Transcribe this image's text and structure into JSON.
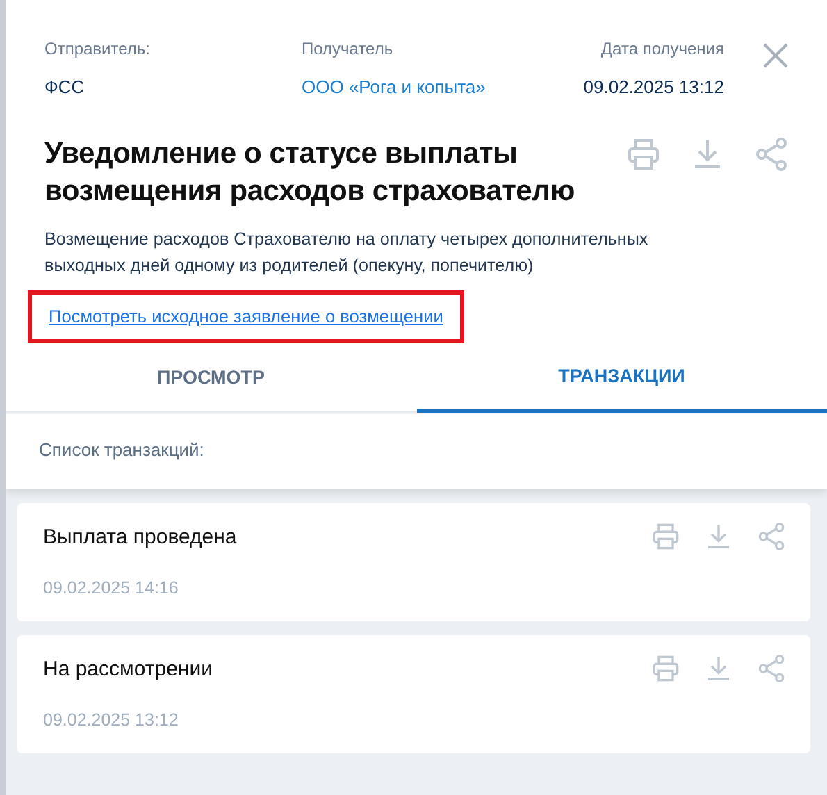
{
  "header": {
    "fields": [
      {
        "label": "Отправитель:",
        "value": "ФСС",
        "kind": "plain"
      },
      {
        "label": "Получатель",
        "value": "ООО «Рога и копыта»",
        "kind": "link"
      },
      {
        "label": "Дата получения",
        "value": "09.02.2025 13:12",
        "kind": "date"
      }
    ]
  },
  "title": "Уведомление о статусе выплаты возмещения расходов страхователю",
  "description": "Возмещение расходов Страхователю на оплату четырех дополнительных выходных дней одному из родителей (опекуну, попечителю)",
  "source_link": {
    "text": "Посмотреть исходное заявление о возмещении",
    "highlighted": true
  },
  "tabs": [
    {
      "label": "ПРОСМОТР",
      "selected": false
    },
    {
      "label": "ТРАНЗАКЦИИ",
      "selected": true
    }
  ],
  "list_title": "Список транзакций:",
  "transactions": [
    {
      "status": "Выплата проведена",
      "date": "09.02.2025 14:16"
    },
    {
      "status": "На рассмотрении",
      "date": "09.02.2025 13:12"
    }
  ]
}
